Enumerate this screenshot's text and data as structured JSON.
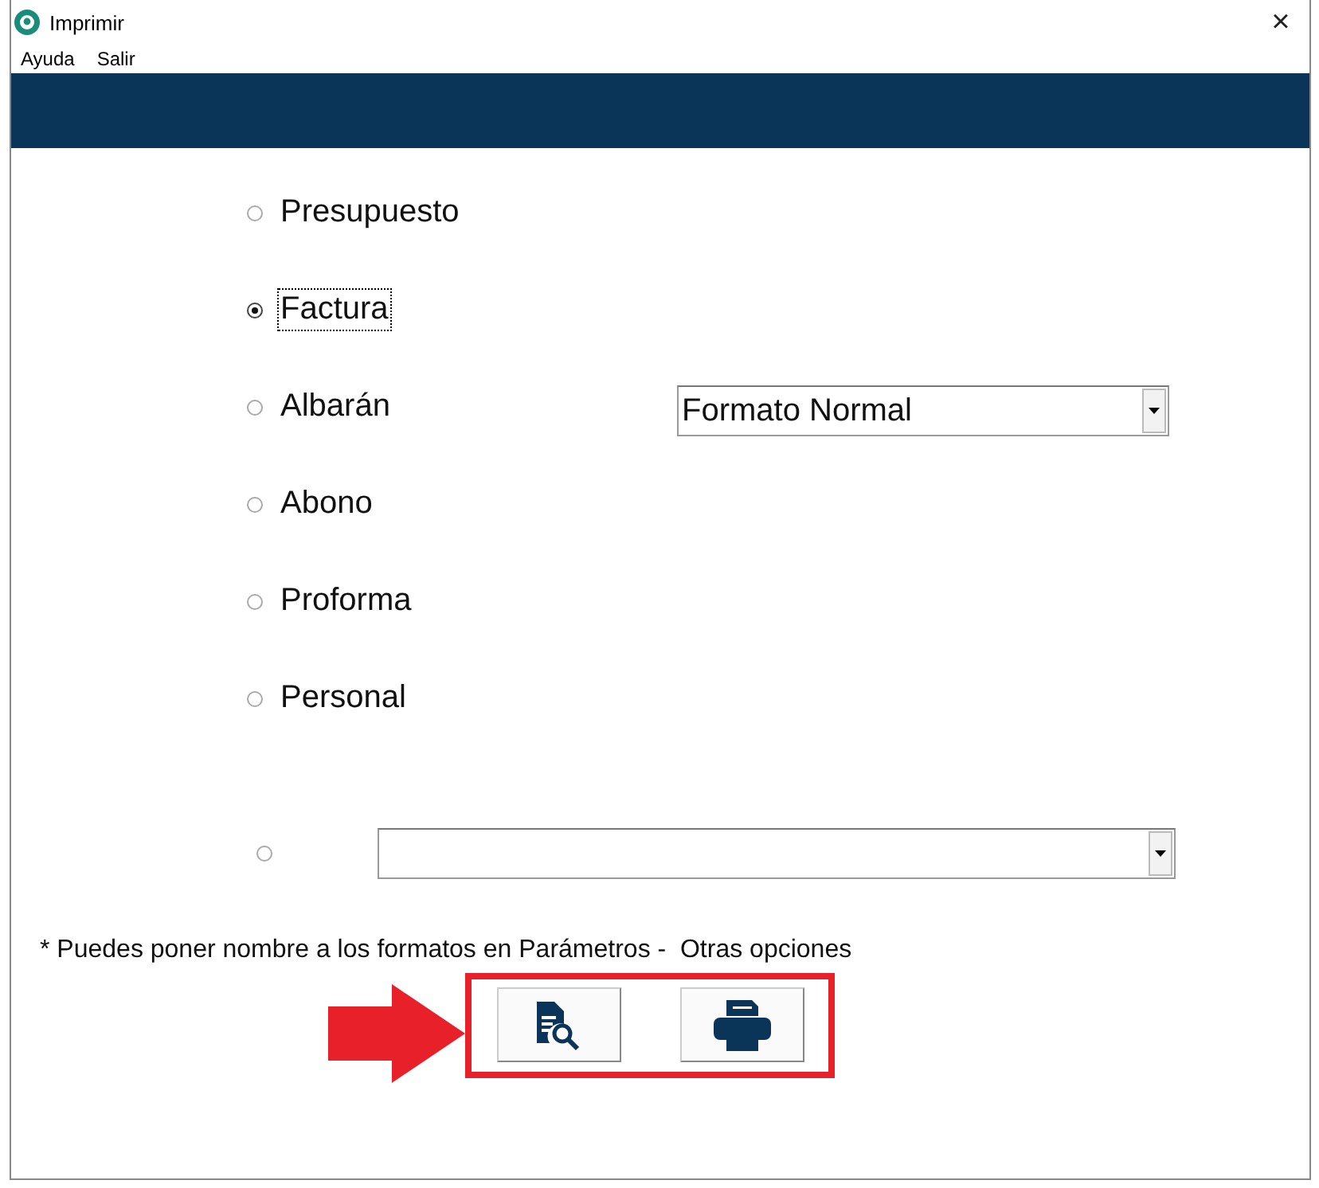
{
  "window": {
    "title": "Imprimir",
    "close": "×"
  },
  "menu": [
    "Ayuda",
    "Salir"
  ],
  "options": [
    {
      "label": "Presupuesto",
      "selected": false,
      "focused": false
    },
    {
      "label": "Factura",
      "selected": true,
      "focused": true
    },
    {
      "label": "Albarán",
      "selected": false,
      "focused": false
    },
    {
      "label": "Abono",
      "selected": false,
      "focused": false
    },
    {
      "label": "Proforma",
      "selected": false,
      "focused": false
    },
    {
      "label": "Personal",
      "selected": false,
      "focused": false
    }
  ],
  "format_select": {
    "value": "Formato Normal"
  },
  "custom_option": {
    "selected": false
  },
  "footnote": "* Puedes poner nombre a los formatos en Parámetros -  Otras opciones",
  "actions": [
    {
      "kind": "preview"
    },
    {
      "kind": "print"
    }
  ]
}
